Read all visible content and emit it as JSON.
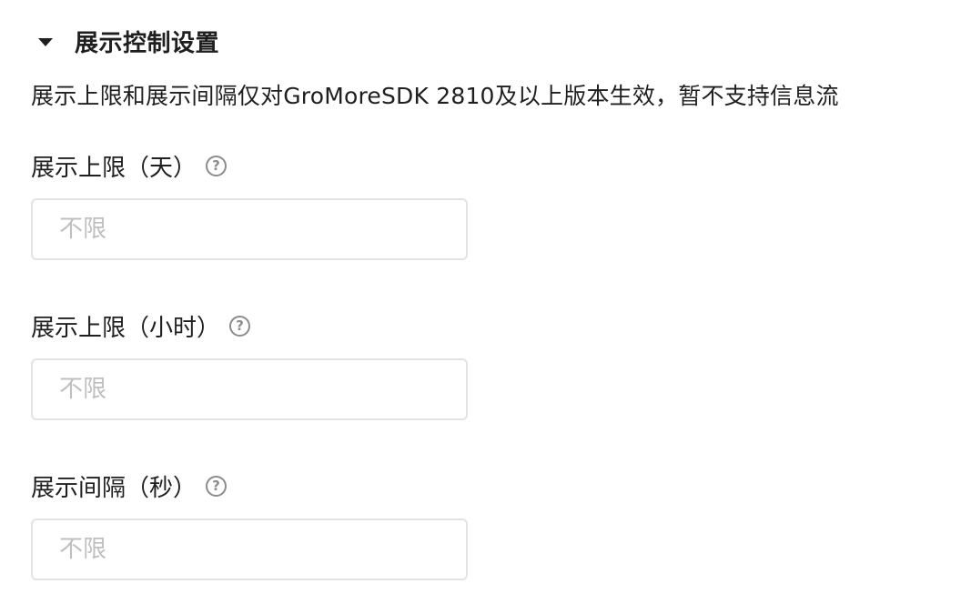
{
  "section": {
    "title": "展示控制设置",
    "expanded": true,
    "notice": "展示上限和展示间隔仅对GroMoreSDK 2810及以上版本生效，暂不支持信息流"
  },
  "fields": [
    {
      "label": "展示上限（天）",
      "help_icon": "question-circle-icon",
      "value": "",
      "placeholder": "不限"
    },
    {
      "label": "展示上限（小时）",
      "help_icon": "question-circle-icon",
      "value": "",
      "placeholder": "不限"
    },
    {
      "label": "展示间隔（秒）",
      "help_icon": "question-circle-icon",
      "value": "",
      "placeholder": "不限"
    }
  ]
}
